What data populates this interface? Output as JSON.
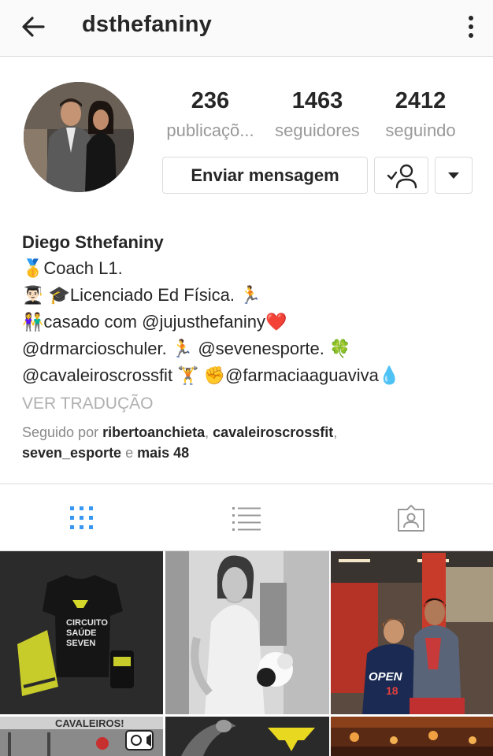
{
  "header": {
    "username": "dsthefaniny",
    "back_icon": "arrow-left-icon",
    "more_icon": "more-vertical-icon"
  },
  "profile": {
    "stats": {
      "posts": {
        "value": "236",
        "label": "publicaçõ..."
      },
      "followers": {
        "value": "1463",
        "label": "seguidores"
      },
      "following": {
        "value": "2412",
        "label": "seguindo"
      }
    },
    "message_button": "Enviar mensagem",
    "following_icon": "person-check-icon",
    "dropdown_icon": "caret-down-icon",
    "full_name": "Diego Sthefaniny",
    "bio_lines": [
      "🥇Coach L1.",
      "👨🏻‍🎓 🎓Licenciado Ed Física. 🏃",
      "👫casado com @jujusthefaniny❤️",
      "@drmarcioschuler. 🏃 @sevenesporte. 🍀",
      "@cavaleiroscrossfit 🏋 ✊@farmaciaaguaviva💧"
    ],
    "translate_link": "VER TRADUÇÃO",
    "followed_by": {
      "prefix": "Seguido por",
      "user1": "ribertoanchieta",
      "user2": "cavaleiroscrossfit",
      "user3": "seven_esporte",
      "conjunction": "e",
      "more": "mais 48"
    }
  },
  "tabs": {
    "grid_icon": "grid-icon",
    "list_icon": "list-icon",
    "tagged_icon": "tagged-person-icon",
    "active_color": "#3897f0",
    "inactive_color": "#999999"
  },
  "posts": {
    "post1": {
      "line1": "CIRCUITO",
      "line2": "SAÚDE",
      "line3": "SEVEN"
    },
    "post3": {
      "shirt_text": "OPEN",
      "shirt_number": "18"
    },
    "post4": {
      "sign_text": "CAVALEIROS!"
    }
  }
}
